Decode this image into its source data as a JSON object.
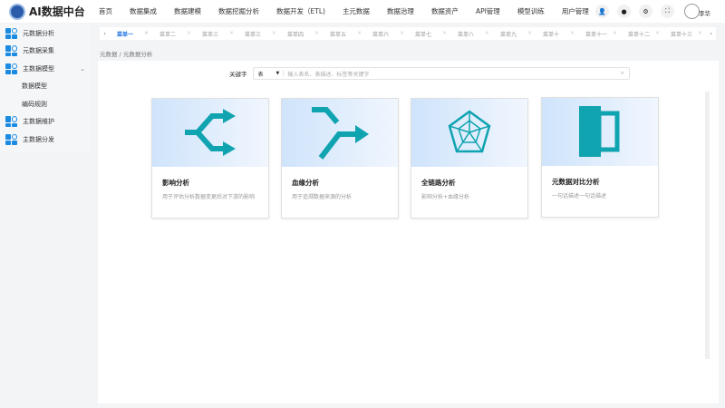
{
  "app": {
    "title": "AI数据中台",
    "user": "李华"
  },
  "nav": [
    "首页",
    "数据集成",
    "数据建模",
    "数据挖掘分析",
    "数据开发（ETL)",
    "主元数据",
    "数据治理",
    "数据资产",
    "API管理",
    "模型训练",
    "用户管理"
  ],
  "sidebar": [
    {
      "label": "元数据分析",
      "icon": true
    },
    {
      "label": "元数据采集",
      "icon": true
    },
    {
      "label": "主数据模型",
      "icon": true,
      "expanded": true
    },
    {
      "label": "数据模型",
      "sub": true
    },
    {
      "label": "编码规则",
      "sub": true
    },
    {
      "label": "主数据维护",
      "icon": true
    },
    {
      "label": "主数据分发",
      "icon": true
    }
  ],
  "tabs": [
    "菜单一",
    "菜单二",
    "菜单三",
    "菜单三",
    "菜单四",
    "菜单五",
    "菜单六",
    "菜单七",
    "菜单八",
    "菜单九",
    "菜单十",
    "菜单十一",
    "菜单十二",
    "菜单十三"
  ],
  "breadcrumb": [
    "元数据",
    "元数据分析"
  ],
  "search": {
    "label": "关键字",
    "select": "表",
    "placeholder": "输入表名、表描述、标签等关键字"
  },
  "cards": [
    {
      "title": "影响分析",
      "desc": "用于评估分析数据变更后对下游的影响",
      "icon": "shuffle-icon"
    },
    {
      "title": "血缘分析",
      "desc": "用于追溯数据来源的分析",
      "icon": "merge-arrow-icon"
    },
    {
      "title": "全链路分析",
      "desc": "影响分析+血缘分析",
      "icon": "radar-icon"
    },
    {
      "title": "元数据对比分析",
      "desc": "一句话描述一句话描述",
      "icon": "compare-icon"
    }
  ],
  "colors": {
    "accent": "#1a6fe0",
    "icon": "#10a3b0"
  }
}
